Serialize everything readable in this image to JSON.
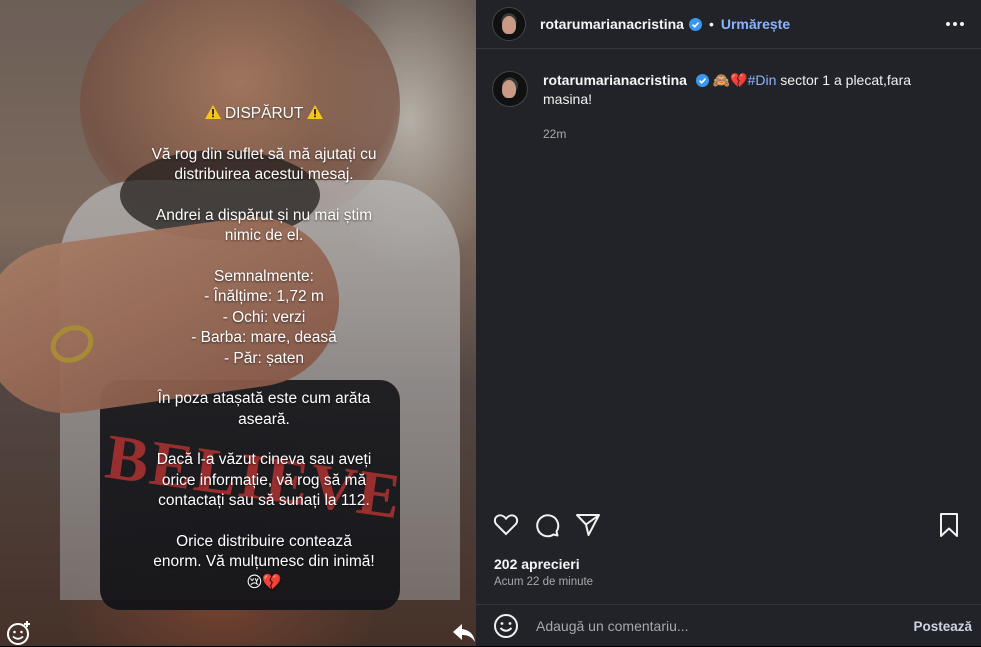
{
  "story": {
    "title": "DISPĂRUT",
    "paragraphs": [
      "Vă rog din suflet să mă ajutați cu distribuirea acestui mesaj.",
      "Andrei a dispărut și nu mai știm nimic de el.",
      "Semnalmente:\n- Înălțime: 1,72 m\n- Ochi: verzi\n- Barba: mare, deasă\n- Păr: șaten",
      "În poza atașată este cum arăta aseară.",
      "Dacă l-a văzut cineva sau aveți orice informație, vă rog să mă contactați sau să sunați la 112.",
      "Orice distribuire contează enorm. Vă mulțumesc din inimă!"
    ],
    "closing_emojis": "😢💔",
    "shirt_text": "BELIEVE"
  },
  "post": {
    "username": "rotarumarianacristina",
    "follow_label": "Urmărește",
    "caption_emojis": "🙈💔",
    "caption_hashtag": "#Din",
    "caption_text": " sector 1 a plecat,fara masina!",
    "caption_time": "22m",
    "likes": "202 aprecieri",
    "time_ago": "Acum 22 de minute",
    "comment_placeholder": "Adaugă un comentariu...",
    "post_label": "Postează"
  },
  "colors": {
    "panel_bg": "#212328",
    "link_blue": "#8ab4ff",
    "verified_blue": "#3897f0",
    "warning_yellow": "#f5c518"
  },
  "icons": [
    "warning-icon",
    "verified-icon",
    "more-options-icon",
    "heart-icon",
    "comment-icon",
    "share-icon",
    "bookmark-icon",
    "emoji-icon",
    "reply-icon",
    "add-sticker-icon"
  ]
}
